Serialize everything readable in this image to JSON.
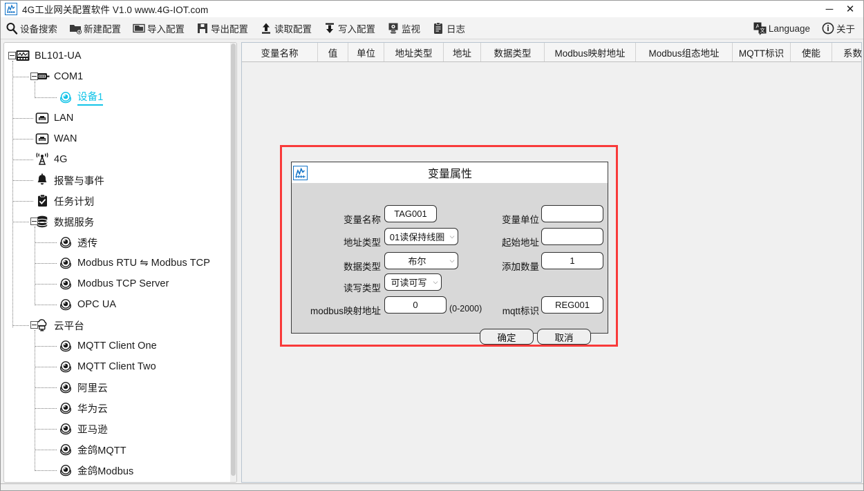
{
  "window": {
    "title": "4G工业网关配置软件 V1.0 www.4G-IOT.com",
    "icon": "app-logo-icon",
    "minimize": "─",
    "close": "✕"
  },
  "toolbar": {
    "items": [
      {
        "label": "设备搜索",
        "icon": "search-icon"
      },
      {
        "label": "新建配置",
        "icon": "new-config-icon"
      },
      {
        "label": "导入配置",
        "icon": "import-config-icon"
      },
      {
        "label": "导出配置",
        "icon": "export-config-icon"
      },
      {
        "label": "读取配置",
        "icon": "upload-arrow-icon"
      },
      {
        "label": "写入配置",
        "icon": "download-arrow-icon"
      },
      {
        "label": "监视",
        "icon": "monitor-icon"
      },
      {
        "label": "日志",
        "icon": "log-icon"
      }
    ],
    "right_items": [
      {
        "label": "Language",
        "icon": "language-icon"
      },
      {
        "label": "关于",
        "icon": "info-icon"
      }
    ]
  },
  "tree": {
    "nodes": [
      {
        "label": "BL101-UA",
        "icon": "gateway-icon",
        "depth": 0,
        "expander": "minus",
        "selected": false
      },
      {
        "label": "COM1",
        "icon": "serial-port-icon",
        "depth": 1,
        "expander": "minus",
        "selected": false
      },
      {
        "label": "设备1",
        "icon": "device-icon",
        "depth": 2,
        "expander": "none",
        "selected": true
      },
      {
        "label": "LAN",
        "icon": "lan-icon",
        "depth": 1,
        "expander": "none",
        "selected": false
      },
      {
        "label": "WAN",
        "icon": "wan-icon",
        "depth": 1,
        "expander": "none",
        "selected": false
      },
      {
        "label": "4G",
        "icon": "antenna-icon",
        "depth": 1,
        "expander": "none",
        "selected": false
      },
      {
        "label": "报警与事件",
        "icon": "bell-icon",
        "depth": 1,
        "expander": "none",
        "selected": false
      },
      {
        "label": "任务计划",
        "icon": "clipboard-check-icon",
        "depth": 1,
        "expander": "none",
        "selected": false
      },
      {
        "label": "数据服务",
        "icon": "database-icon",
        "depth": 1,
        "expander": "minus",
        "selected": false
      },
      {
        "label": "透传",
        "icon": "node-dot-icon",
        "depth": 2,
        "expander": "none",
        "selected": false
      },
      {
        "label": "Modbus RTU ⇋ Modbus TCP",
        "icon": "node-dot-icon",
        "depth": 2,
        "expander": "none",
        "selected": false
      },
      {
        "label": "Modbus TCP Server",
        "icon": "node-dot-icon",
        "depth": 2,
        "expander": "none",
        "selected": false
      },
      {
        "label": "OPC UA",
        "icon": "node-dot-icon",
        "depth": 2,
        "expander": "none",
        "selected": false
      },
      {
        "label": "云平台",
        "icon": "cloud-icon",
        "depth": 1,
        "expander": "minus",
        "selected": false
      },
      {
        "label": "MQTT Client One",
        "icon": "node-dot-icon",
        "depth": 2,
        "expander": "none",
        "selected": false
      },
      {
        "label": "MQTT Client Two",
        "icon": "node-dot-icon",
        "depth": 2,
        "expander": "none",
        "selected": false
      },
      {
        "label": "阿里云",
        "icon": "node-dot-icon",
        "depth": 2,
        "expander": "none",
        "selected": false
      },
      {
        "label": "华为云",
        "icon": "node-dot-icon",
        "depth": 2,
        "expander": "none",
        "selected": false
      },
      {
        "label": "亚马逊",
        "icon": "node-dot-icon",
        "depth": 2,
        "expander": "none",
        "selected": false
      },
      {
        "label": "金鸽MQTT",
        "icon": "node-dot-icon",
        "depth": 2,
        "expander": "none",
        "selected": false
      },
      {
        "label": "金鸽Modbus",
        "icon": "node-dot-icon",
        "depth": 2,
        "expander": "none",
        "selected": false
      }
    ]
  },
  "grid": {
    "columns": [
      {
        "label": "变量名称",
        "width": 110
      },
      {
        "label": "值",
        "width": 44
      },
      {
        "label": "单位",
        "width": 52
      },
      {
        "label": "地址类型",
        "width": 86
      },
      {
        "label": "地址",
        "width": 54
      },
      {
        "label": "数据类型",
        "width": 92
      },
      {
        "label": "Modbus映射地址",
        "width": 132
      },
      {
        "label": "Modbus组态地址",
        "width": 140
      },
      {
        "label": "MQTT标识",
        "width": 84
      },
      {
        "label": "使能",
        "width": 60
      },
      {
        "label": "系数",
        "width": 60
      }
    ],
    "rows": []
  },
  "dialog": {
    "title": "变量属性",
    "icon": "app-logo-icon",
    "fields": {
      "tag_name_label": "变量名称",
      "tag_name_value": "TAG001",
      "unit_label": "变量单位",
      "unit_value": "",
      "addr_type_label": "地址类型",
      "addr_type_value": "01读保持线圈",
      "start_addr_label": "起始地址",
      "start_addr_value": "",
      "data_type_label": "数据类型",
      "data_type_value": "布尔",
      "add_count_label": "添加数量",
      "add_count_value": "1",
      "rw_type_label": "读写类型",
      "rw_type_value": "可读可写",
      "modbus_map_label": "modbus映射地址",
      "modbus_map_value": "0",
      "modbus_map_hint": "(0-2000)",
      "mqtt_id_label": "mqtt标识",
      "mqtt_id_value": "REG001"
    },
    "buttons": {
      "ok": "确定",
      "cancel": "取消"
    }
  },
  "colors": {
    "accent_cyan": "#13c4e8",
    "alert_red": "#f93a3a",
    "dialog_bg": "#d8d8d8",
    "app_bg": "#f0f0f0"
  }
}
